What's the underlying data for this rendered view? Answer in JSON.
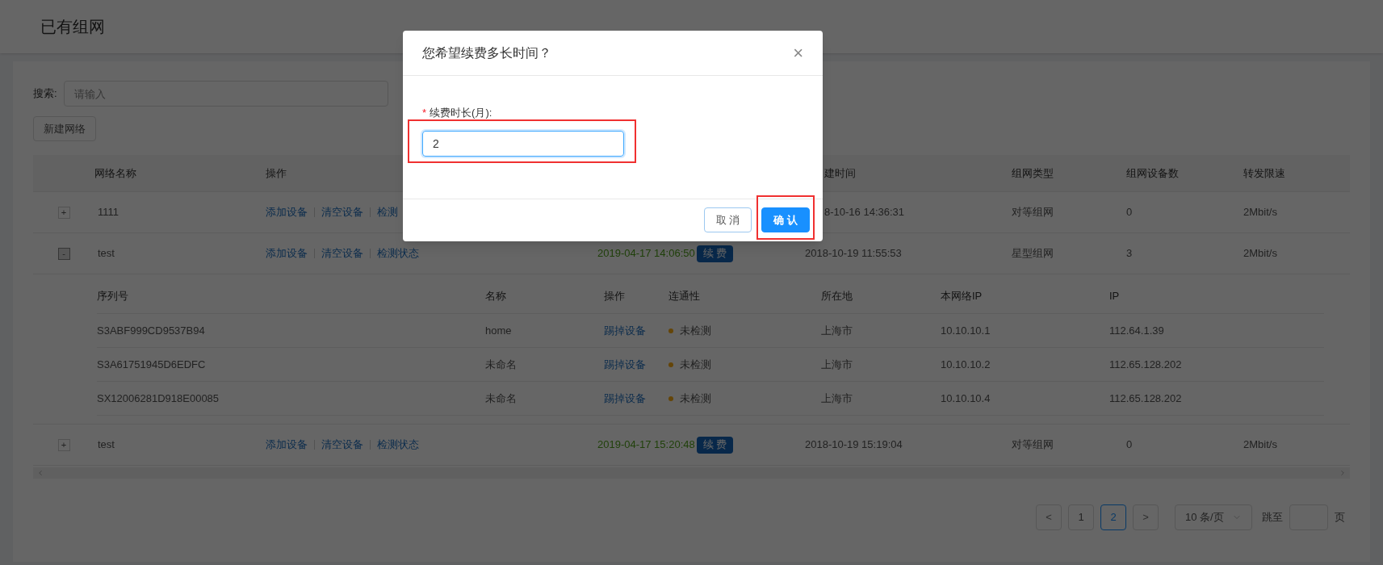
{
  "page_title": "已有组网",
  "search": {
    "label": "搜索:",
    "placeholder": "请输入"
  },
  "new_button": "新建网络",
  "table": {
    "columns": {
      "name": "网络名称",
      "actions": "操作",
      "created": "建时间",
      "type": "组网类型",
      "count": "组网设备数",
      "speed": "转发限速"
    },
    "rows": [
      {
        "toggle": "+",
        "expanded": false,
        "name": "1111",
        "actions": [
          "添加设备",
          "清空设备",
          "检测"
        ],
        "created": "8-10-16 14:36:31",
        "type": "对等组网",
        "count": "0",
        "speed": "2Mbit/s"
      },
      {
        "toggle": "-",
        "expanded": true,
        "name": "test",
        "actions": [
          "添加设备",
          "清空设备",
          "检测状态"
        ],
        "expiry": "2019-04-17 14:06:50",
        "renew": "续 费",
        "created": "2018-10-19 11:55:53",
        "type": "星型组网",
        "count": "3",
        "speed": "2Mbit/s",
        "devices": {
          "columns": [
            "序列号",
            "名称",
            "操作",
            "连通性",
            "所在地",
            "本网络IP",
            "IP"
          ],
          "rows": [
            {
              "serial": "S3ABF999CD9537B94",
              "name": "home",
              "action": "踢掉设备",
              "status": "未检测",
              "color": "#644508",
              "location": "上海市",
              "lan_ip": "10.10.10.1",
              "ip": "112.64.1.39"
            },
            {
              "serial": "S3A61751945D6EDFC",
              "name": "未命名",
              "action": "踢掉设备",
              "status": "未检测",
              "color": "#644508",
              "location": "上海市",
              "lan_ip": "10.10.10.2",
              "ip": "112.65.128.202"
            },
            {
              "serial": "SX12006281D918E00085",
              "name": "未命名",
              "action": "踢掉设备",
              "status": "未检测",
              "color": "#644508",
              "location": "上海市",
              "lan_ip": "10.10.10.4",
              "ip": "112.65.128.202"
            }
          ]
        }
      },
      {
        "toggle": "+",
        "expanded": false,
        "name": "test",
        "actions": [
          "添加设备",
          "清空设备",
          "检测状态"
        ],
        "expiry": "2019-04-17 15:20:48",
        "renew": "续 费",
        "created": "2018-10-19 15:19:04",
        "type": "对等组网",
        "count": "0",
        "speed": "2Mbit/s"
      }
    ]
  },
  "pagination": {
    "prev": "<",
    "pages": [
      {
        "label": "1",
        "selected": false
      },
      {
        "label": "2",
        "selected": true
      }
    ],
    "next": ">",
    "page_size": "10 条/页",
    "jump_label": "跳至",
    "jump_suffix": "页"
  },
  "modal": {
    "title": "您希望续费多长时间？",
    "close": "×",
    "required_mark": "*",
    "label": "续费时长(月):",
    "value": "2",
    "buttons": [
      {
        "label": "取 消",
        "kind": "secondary"
      },
      {
        "label": "确 认",
        "kind": "primary"
      }
    ]
  }
}
